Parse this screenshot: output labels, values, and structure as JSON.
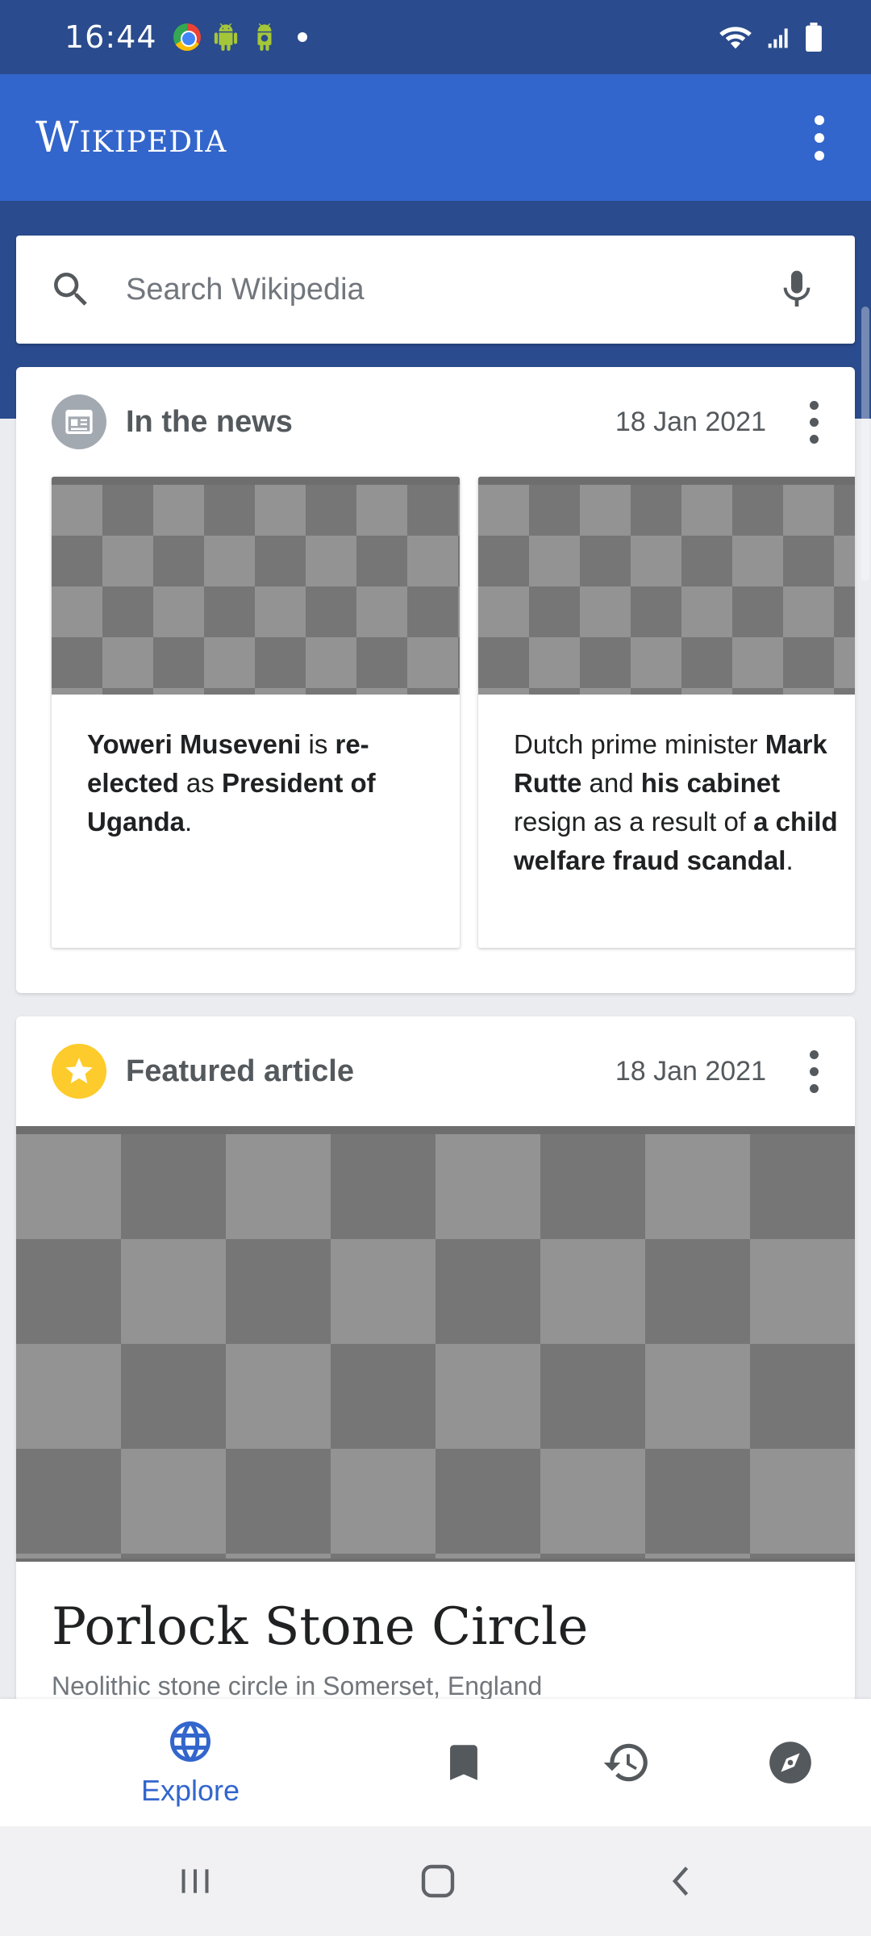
{
  "status_bar": {
    "time": "16:44"
  },
  "app_bar": {
    "title": "Wikipedia"
  },
  "search": {
    "placeholder": "Search Wikipedia"
  },
  "news_card": {
    "title": "In the news",
    "date": "18 Jan 2021",
    "items": [
      {
        "segments": [
          {
            "text": "Yoweri Museveni",
            "bold": true
          },
          {
            "text": " is ",
            "bold": false
          },
          {
            "text": "re-elected",
            "bold": true
          },
          {
            "text": " as ",
            "bold": false
          },
          {
            "text": "President of Uganda",
            "bold": true
          },
          {
            "text": ".",
            "bold": false
          }
        ]
      },
      {
        "segments": [
          {
            "text": "Dutch prime minister ",
            "bold": false
          },
          {
            "text": "Mark Rutte",
            "bold": true
          },
          {
            "text": " and ",
            "bold": false
          },
          {
            "text": "his cabinet",
            "bold": true
          },
          {
            "text": " resign as a result of ",
            "bold": false
          },
          {
            "text": "a child welfare fraud scandal",
            "bold": true
          },
          {
            "text": ".",
            "bold": false
          }
        ]
      }
    ]
  },
  "featured_card": {
    "title": "Featured article",
    "date": "18 Jan 2021",
    "article_title": "Porlock Stone Circle",
    "article_description": "Neolithic stone circle in Somerset, England"
  },
  "bottom_nav": {
    "explore_label": "Explore",
    "active_color": "#3366cc",
    "inactive_color": "#54595d",
    "icons": [
      "explore-globe-icon",
      "saved-bookmark-icon",
      "history-icon",
      "nearby-compass-icon"
    ]
  },
  "colors": {
    "brand": "#3366cc",
    "brand_dark": "#2a4b8d",
    "featured_star": "#fdcb2b"
  }
}
